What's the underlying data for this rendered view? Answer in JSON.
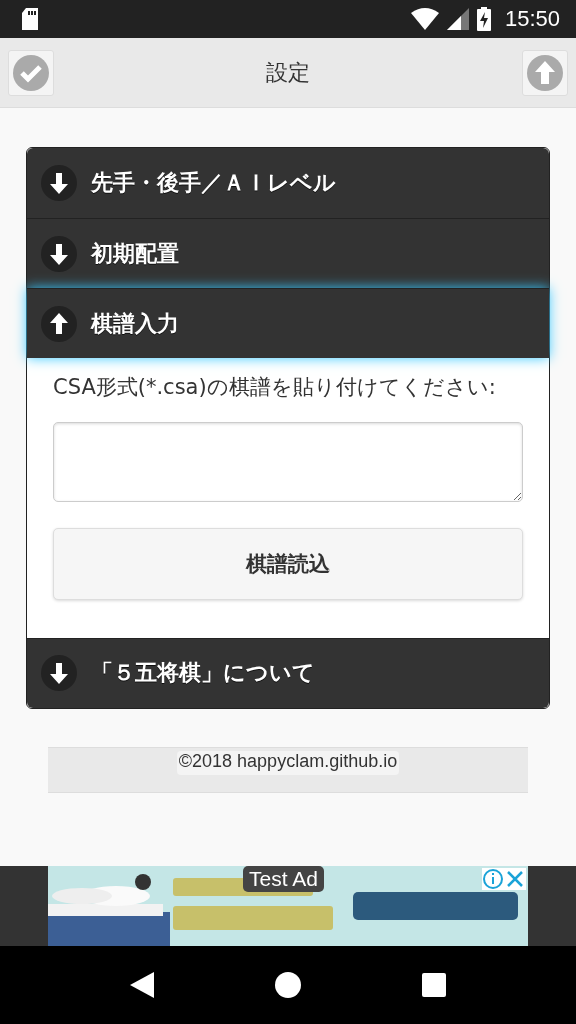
{
  "status_bar": {
    "time": "15:50"
  },
  "header": {
    "title": "設定"
  },
  "sections": [
    {
      "title": "先手・後手／ＡＩレベル",
      "expanded": false
    },
    {
      "title": "初期配置",
      "expanded": false
    },
    {
      "title": "棋譜入力",
      "expanded": true,
      "instruction": "CSA形式(*.csa)の棋譜を貼り付けてください:",
      "button": "棋譜読込"
    },
    {
      "title": "「５五将棋」について",
      "expanded": false
    }
  ],
  "footer": {
    "text": "©2018 happyclam.github.io"
  },
  "ad": {
    "label": "Test Ad",
    "kind": "picture"
  }
}
